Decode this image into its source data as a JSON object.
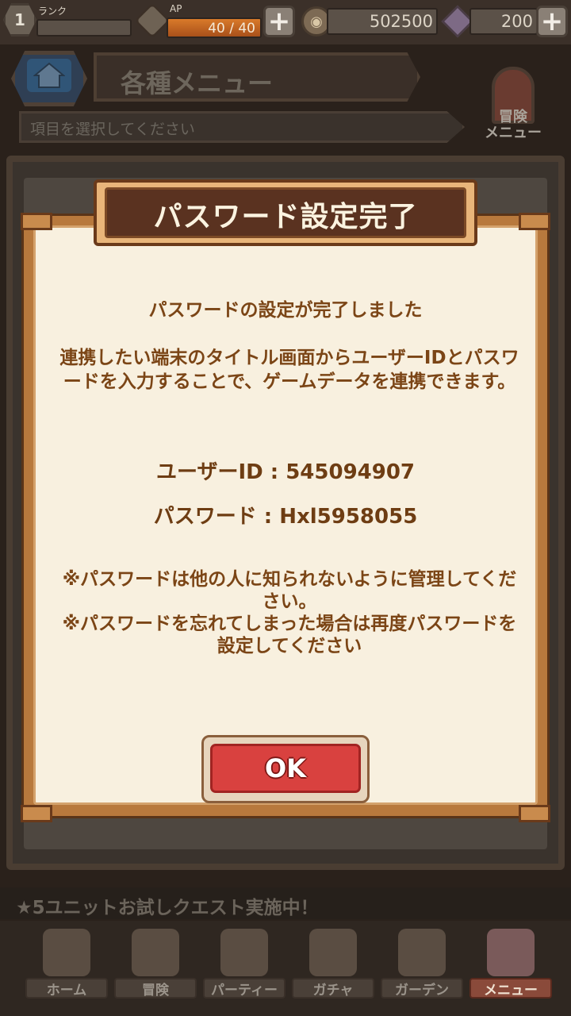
{
  "status_bar": {
    "rank_value": "1",
    "rank_label": "ランク",
    "ap_label": "AP",
    "ap_text": "40 / 40",
    "ap_fill_fraction": 1.0,
    "money": "502500",
    "gems": "200",
    "plus_symbol": "+"
  },
  "header": {
    "title": "各種メニュー",
    "subtitle": "項目を選択してください",
    "adventure_menu_label": "冒険\nメニュー"
  },
  "dialog": {
    "title": "パスワード設定完了",
    "main_message": "パスワードの設定が完了しました",
    "description": "連携したい端末のタイトル画面からユーザーIDとパスワードを入力することで、ゲームデータを連携できます。",
    "user_id_line": "ユーザーID : 545094907",
    "password_line": "パスワード : Hxl5958055",
    "note_1": "※パスワードは他の人に知られないように管理してください。",
    "note_2": "※パスワードを忘れてしまった場合は再度パスワードを設定してください",
    "ok_label": "OK"
  },
  "ticker": {
    "text": "★5ユニットお試しクエスト実施中！"
  },
  "nav": {
    "items": [
      {
        "label": "ホーム",
        "icon": "house-icon"
      },
      {
        "label": "冒険",
        "icon": "compass-icon"
      },
      {
        "label": "パーティー",
        "icon": "chess-pieces-icon"
      },
      {
        "label": "ガチャ",
        "icon": "gacha-dice-icon"
      },
      {
        "label": "ガーデン",
        "icon": "lock-icon"
      },
      {
        "label": "メニュー",
        "icon": "book-icon"
      }
    ],
    "active_index": 5
  },
  "colors": {
    "dialog_text": "#7b4516",
    "ok_button": "#d9413f",
    "dialog_background": "#f8f0df"
  }
}
